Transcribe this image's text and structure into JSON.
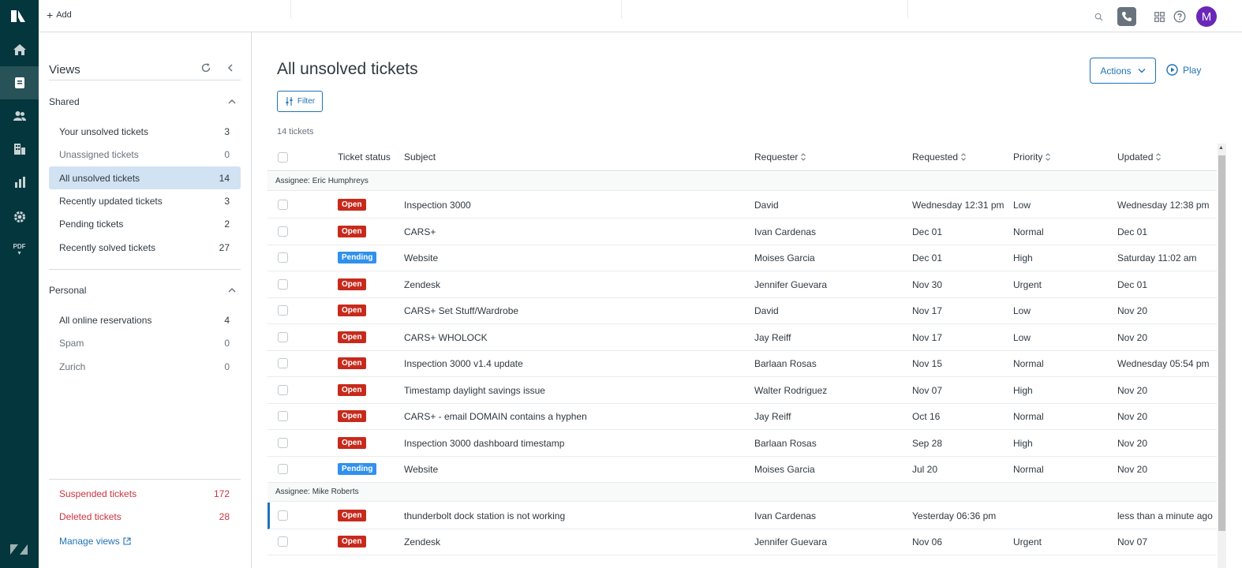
{
  "topbar": {
    "add_label": "Add",
    "avatar_initial": "M"
  },
  "views": {
    "title": "Views",
    "shared_label": "Shared",
    "personal_label": "Personal",
    "shared_items": [
      {
        "label": "Your unsolved tickets",
        "count": "3"
      },
      {
        "label": "Unassigned tickets",
        "count": "0"
      },
      {
        "label": "All unsolved tickets",
        "count": "14"
      },
      {
        "label": "Recently updated tickets",
        "count": "3"
      },
      {
        "label": "Pending tickets",
        "count": "2"
      },
      {
        "label": "Recently solved tickets",
        "count": "27"
      }
    ],
    "personal_items": [
      {
        "label": "All online reservations",
        "count": "4"
      },
      {
        "label": "Spam",
        "count": "0"
      },
      {
        "label": "Zurich",
        "count": "0"
      }
    ],
    "suspended": {
      "label": "Suspended tickets",
      "count": "172"
    },
    "deleted": {
      "label": "Deleted tickets",
      "count": "28"
    },
    "manage_label": "Manage views"
  },
  "main": {
    "title": "All unsolved tickets",
    "actions_label": "Actions",
    "play_label": "Play",
    "filter_label": "Filter",
    "count_label": "14 tickets"
  },
  "table": {
    "headers": {
      "status": "Ticket status",
      "subject": "Subject",
      "requester": "Requester",
      "requested": "Requested",
      "priority": "Priority",
      "updated": "Updated"
    },
    "groups": [
      {
        "label": "Assignee: Eric Humphreys",
        "rows": [
          {
            "status": "Open",
            "subject": "Inspection 3000",
            "requester": "David",
            "requested": "Wednesday 12:31 pm",
            "priority": "Low",
            "updated": "Wednesday 12:38 pm"
          },
          {
            "status": "Open",
            "subject": "CARS+",
            "requester": "Ivan Cardenas",
            "requested": "Dec 01",
            "priority": "Normal",
            "updated": "Dec 01"
          },
          {
            "status": "Pending",
            "subject": "Website",
            "requester": "Moises Garcia",
            "requested": "Dec 01",
            "priority": "High",
            "updated": "Saturday 11:02 am"
          },
          {
            "status": "Open",
            "subject": "Zendesk",
            "requester": "Jennifer Guevara",
            "requested": "Nov 30",
            "priority": "Urgent",
            "updated": "Dec 01"
          },
          {
            "status": "Open",
            "subject": "CARS+ Set Stuff/Wardrobe",
            "requester": "David",
            "requested": "Nov 17",
            "priority": "Low",
            "updated": "Nov 20"
          },
          {
            "status": "Open",
            "subject": "CARS+ WHOLOCK",
            "requester": "Jay Reiff",
            "requested": "Nov 17",
            "priority": "Low",
            "updated": "Nov 20"
          },
          {
            "status": "Open",
            "subject": "Inspection 3000 v1.4 update",
            "requester": "Barlaan Rosas",
            "requested": "Nov 15",
            "priority": "Normal",
            "updated": "Wednesday 05:54 pm"
          },
          {
            "status": "Open",
            "subject": "Timestamp daylight savings issue",
            "requester": "Walter Rodriguez",
            "requested": "Nov 07",
            "priority": "High",
            "updated": "Nov 20"
          },
          {
            "status": "Open",
            "subject": "CARS+ - email DOMAIN contains a hyphen",
            "requester": "Jay Reiff",
            "requested": "Oct 16",
            "priority": "Normal",
            "updated": "Nov 20"
          },
          {
            "status": "Open",
            "subject": "Inspection 3000 dashboard timestamp",
            "requester": "Barlaan Rosas",
            "requested": "Sep 28",
            "priority": "High",
            "updated": "Nov 20"
          },
          {
            "status": "Pending",
            "subject": "Website",
            "requester": "Moises Garcia",
            "requested": "Jul 20",
            "priority": "Normal",
            "updated": "Nov 20"
          }
        ]
      },
      {
        "label": "Assignee: Mike Roberts",
        "rows": [
          {
            "status": "Open",
            "subject": "thunderbolt dock station is not working",
            "requester": "Ivan Cardenas",
            "requested": "Yesterday 06:36 pm",
            "priority": "",
            "updated": "less than a minute ago"
          },
          {
            "status": "Open",
            "subject": "Zendesk",
            "requester": "Jennifer Guevara",
            "requested": "Nov 06",
            "priority": "Urgent",
            "updated": "Nov 07"
          }
        ]
      }
    ]
  },
  "colors": {
    "rail": "#03363d",
    "accent": "#1f73b7",
    "open": "#c72a1c",
    "pending": "#3091ec",
    "danger": "#cc3340",
    "avatar": "#6a27b8"
  }
}
